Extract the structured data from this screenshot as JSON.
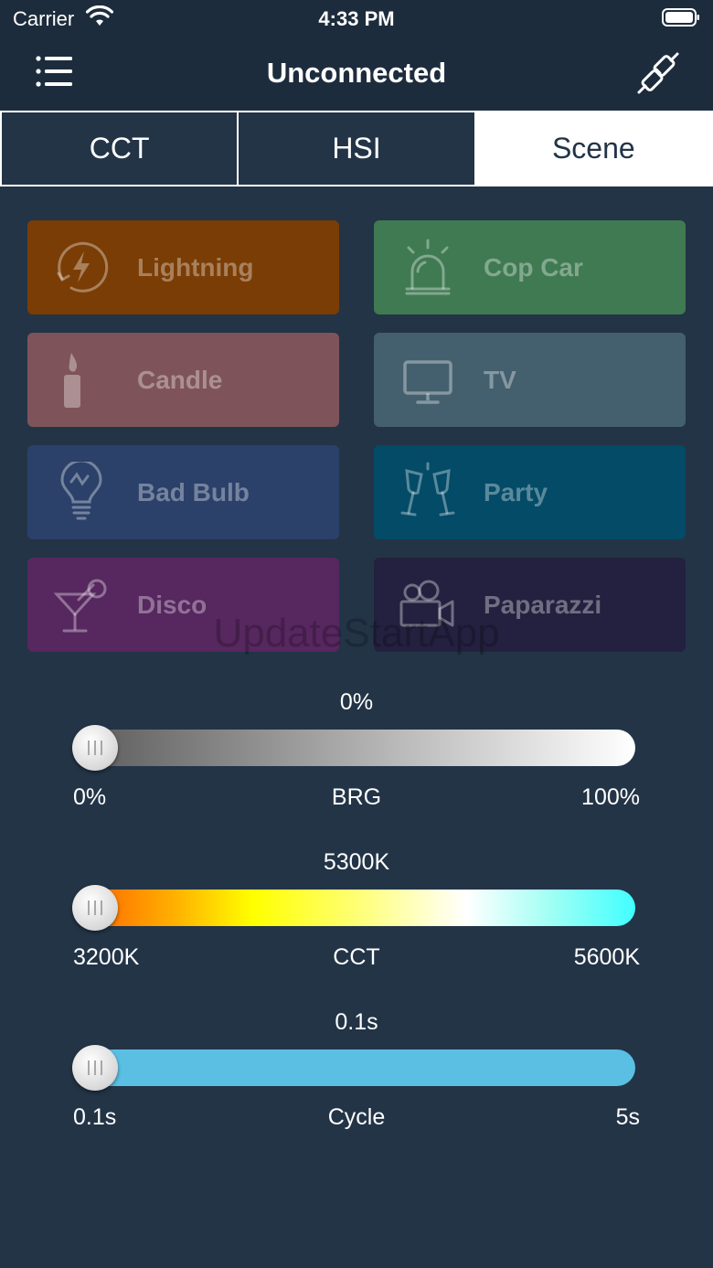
{
  "status_bar": {
    "carrier": "Carrier",
    "time": "4:33 PM"
  },
  "nav": {
    "title": "Unconnected",
    "menu_icon": "list-menu-icon",
    "connect_icon": "plug-disconnect-icon"
  },
  "tabs": [
    {
      "label": "CCT",
      "active": false
    },
    {
      "label": "HSI",
      "active": false
    },
    {
      "label": "Scene",
      "active": true
    }
  ],
  "scenes": [
    {
      "label": "Lightning",
      "icon": "lightning-icon",
      "color": "#7a3d05"
    },
    {
      "label": "Cop Car",
      "icon": "police-siren-icon",
      "color": "#3f7a52"
    },
    {
      "label": "Candle",
      "icon": "candle-icon",
      "color": "#7e545a"
    },
    {
      "label": "TV",
      "icon": "tv-icon",
      "color": "#44606e"
    },
    {
      "label": "Bad Bulb",
      "icon": "lightbulb-icon",
      "color": "#2b416a"
    },
    {
      "label": "Party",
      "icon": "champagne-glasses-icon",
      "color": "#034b67"
    },
    {
      "label": "Disco",
      "icon": "cocktail-icon",
      "color": "#57275f"
    },
    {
      "label": "Paparazzi",
      "icon": "video-camera-icon",
      "color": "#23213f"
    }
  ],
  "watermark": "UpdateStartApp",
  "sliders": {
    "brightness": {
      "value": "0%",
      "min": "0%",
      "label": "BRG",
      "max": "100%",
      "level": 0
    },
    "cct": {
      "value": "5300K",
      "min": "3200K",
      "label": "CCT",
      "max": "5600K",
      "level": 0
    },
    "cycle": {
      "value": "0.1s",
      "min": "0.1s",
      "label": "Cycle",
      "max": "5s",
      "level": 0
    }
  },
  "colors": {
    "background": "#233447",
    "bar": "#1d2c3c",
    "cycle_track": "#5bbfe3"
  }
}
